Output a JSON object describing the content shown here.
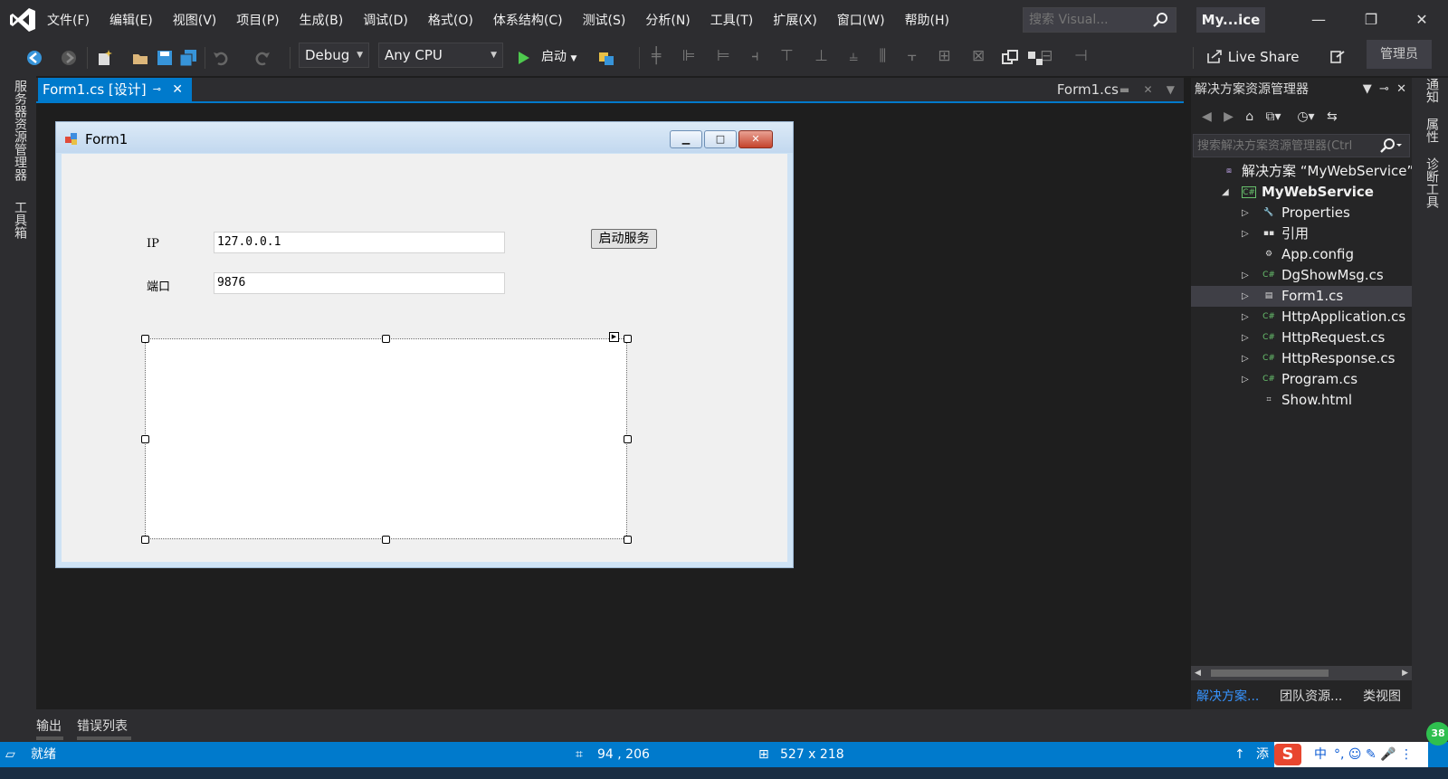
{
  "menu": [
    "文件(F)",
    "编辑(E)",
    "视图(V)",
    "项目(P)",
    "生成(B)",
    "调试(D)",
    "格式(O)",
    "体系结构(C)",
    "测试(S)",
    "分析(N)",
    "工具(T)",
    "扩展(X)",
    "窗口(W)",
    "帮助(H)"
  ],
  "search": {
    "placeholder": "搜索 Visual..."
  },
  "solution_short_title": "My...ice",
  "toolbar": {
    "config": "Debug",
    "platform": "Any CPU",
    "start_label": "启动",
    "live_share": "Live Share",
    "admin": "管理员"
  },
  "left_strip": [
    "服务器资源管理器",
    "工具箱"
  ],
  "right_strip": [
    "通知",
    "属性",
    "诊断工具"
  ],
  "tabs": {
    "active": "Form1.cs [设计]",
    "right": "Form1.cs"
  },
  "form": {
    "title": "Form1",
    "ip_label": "IP",
    "ip_value": "127.0.0.1",
    "port_label": "端口",
    "port_value": "9876",
    "start_button": "启动服务"
  },
  "solution_explorer": {
    "title": "解决方案资源管理器",
    "search_placeholder": "搜索解决方案资源管理器(Ctrl",
    "tree": [
      {
        "label": "解决方案 “MyWebService” (",
        "icon": "solution-icon",
        "expander": ""
      },
      {
        "label": "MyWebService",
        "icon": "csharp-project-icon",
        "expander": "expanded"
      },
      {
        "label": "Properties",
        "icon": "wrench-icon",
        "expander": "collapsed"
      },
      {
        "label": "引用",
        "icon": "references-icon",
        "expander": "collapsed"
      },
      {
        "label": "App.config",
        "icon": "config-file-icon",
        "expander": ""
      },
      {
        "label": "DgShowMsg.cs",
        "icon": "csharp-file-icon",
        "expander": "collapsed"
      },
      {
        "label": "Form1.cs",
        "icon": "form-file-icon",
        "expander": "collapsed",
        "selected": true
      },
      {
        "label": "HttpApplication.cs",
        "icon": "csharp-file-icon",
        "expander": "collapsed"
      },
      {
        "label": "HttpRequest.cs",
        "icon": "csharp-file-icon",
        "expander": "collapsed"
      },
      {
        "label": "HttpResponse.cs",
        "icon": "csharp-file-icon",
        "expander": "collapsed"
      },
      {
        "label": "Program.cs",
        "icon": "csharp-file-icon",
        "expander": "collapsed"
      },
      {
        "label": "Show.html",
        "icon": "html-file-icon",
        "expander": ""
      }
    ],
    "bottom_tabs": [
      "解决方案...",
      "团队资源...",
      "类视图"
    ]
  },
  "bottom_tabs": [
    "输出",
    "错误列表"
  ],
  "status": {
    "ready": "就绪",
    "position": "94 , 206",
    "size": "527 x 218",
    "add_label": "添"
  },
  "ime": {
    "mode": "中",
    "badge": "38"
  },
  "colors": {
    "accent": "#007acc",
    "background": "#1e1e1e",
    "chrome": "#2d2d30"
  }
}
